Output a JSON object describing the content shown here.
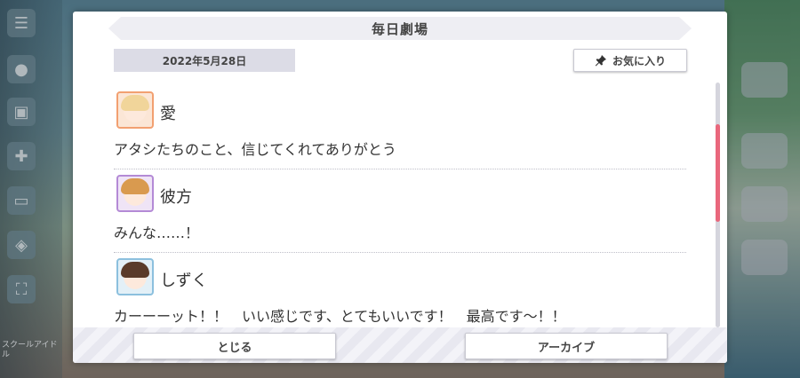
{
  "background": {
    "side_label": "スクールアイドル"
  },
  "dialog": {
    "title": "毎日劇場",
    "date": "2022年5月28日",
    "favorite_label": "お気に入り",
    "entries": [
      {
        "speaker": "愛",
        "line": "アタシたちのこと、信じてくれてありがとう"
      },
      {
        "speaker": "彼方",
        "line": "みんな……！"
      },
      {
        "speaker": "しずく",
        "line": "カーーーット！！　いい感じです、とてもいいです！　最高です～！！"
      }
    ],
    "close_label": "とじる",
    "archive_label": "アーカイブ"
  },
  "colors": {
    "scroll_thumb": "#e9677c",
    "avatar_ai_border": "#f2a071",
    "avatar_kanata_border": "#b48ad6",
    "avatar_shizuku_border": "#8cc0de"
  }
}
